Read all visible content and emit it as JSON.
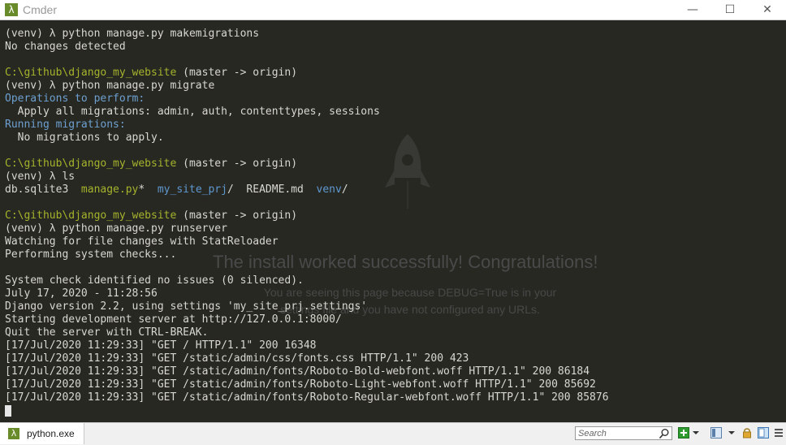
{
  "window": {
    "title": "Cmder",
    "app_icon_glyph": "λ",
    "controls": {
      "minimize": "—",
      "maximize": "☐",
      "close": "✕"
    }
  },
  "watermark": {
    "headline": "The install worked successfully! Congratulations!",
    "body": "You are seeing this page because DEBUG=True is in your settings file and you have not configured any URLs."
  },
  "terminal": {
    "lines": [
      [
        {
          "t": "(venv) λ python manage.py makemigrations",
          "c": "w"
        }
      ],
      [
        {
          "t": "No changes detected",
          "c": "w"
        }
      ],
      [
        {
          "t": "",
          "c": "w"
        }
      ],
      [
        {
          "t": "C:\\github\\django_my_website",
          "c": "g"
        },
        {
          "t": " (master -> origin)",
          "c": "w"
        }
      ],
      [
        {
          "t": "(venv) λ python manage.py migrate",
          "c": "w"
        }
      ],
      [
        {
          "t": "Operations to perform:",
          "c": "c"
        }
      ],
      [
        {
          "t": "  Apply all migrations:",
          "c": "w"
        },
        {
          "t": " admin, auth, contenttypes, sessions",
          "c": "w"
        }
      ],
      [
        {
          "t": "Running migrations:",
          "c": "c"
        }
      ],
      [
        {
          "t": "  No migrations to apply.",
          "c": "w"
        }
      ],
      [
        {
          "t": "",
          "c": "w"
        }
      ],
      [
        {
          "t": "C:\\github\\django_my_website",
          "c": "g"
        },
        {
          "t": " (master -> origin)",
          "c": "w"
        }
      ],
      [
        {
          "t": "(venv) λ ls",
          "c": "w"
        }
      ],
      [
        {
          "t": "db.sqlite3  ",
          "c": "w"
        },
        {
          "t": "manage.py",
          "c": "g"
        },
        {
          "t": "*  ",
          "c": "w"
        },
        {
          "t": "my_site_prj",
          "c": "b"
        },
        {
          "t": "/  README.md  ",
          "c": "w"
        },
        {
          "t": "venv",
          "c": "b"
        },
        {
          "t": "/",
          "c": "w"
        }
      ],
      [
        {
          "t": "",
          "c": "w"
        }
      ],
      [
        {
          "t": "C:\\github\\django_my_website",
          "c": "g"
        },
        {
          "t": " (master -> origin)",
          "c": "w"
        }
      ],
      [
        {
          "t": "(venv) λ python manage.py runserver",
          "c": "w"
        }
      ],
      [
        {
          "t": "Watching for file changes with StatReloader",
          "c": "w"
        }
      ],
      [
        {
          "t": "Performing system checks...",
          "c": "w"
        }
      ],
      [
        {
          "t": "",
          "c": "w"
        }
      ],
      [
        {
          "t": "System check identified no issues (0 silenced).",
          "c": "w"
        }
      ],
      [
        {
          "t": "July 17, 2020 - 11:28:56",
          "c": "w"
        }
      ],
      [
        {
          "t": "Django version 2.2, using settings 'my_site_prj.settings'",
          "c": "w"
        }
      ],
      [
        {
          "t": "Starting development server at http://127.0.0.1:8000/",
          "c": "w"
        }
      ],
      [
        {
          "t": "Quit the server with CTRL-BREAK.",
          "c": "w"
        }
      ],
      [
        {
          "t": "[17/Jul/2020 11:29:33] \"GET / HTTP/1.1\" 200 16348",
          "c": "w"
        }
      ],
      [
        {
          "t": "[17/Jul/2020 11:29:33] \"GET /static/admin/css/fonts.css HTTP/1.1\" 200 423",
          "c": "w"
        }
      ],
      [
        {
          "t": "[17/Jul/2020 11:29:33] \"GET /static/admin/fonts/Roboto-Bold-webfont.woff HTTP/1.1\" 200 86184",
          "c": "w"
        }
      ],
      [
        {
          "t": "[17/Jul/2020 11:29:33] \"GET /static/admin/fonts/Roboto-Light-webfont.woff HTTP/1.1\" 200 85692",
          "c": "w"
        }
      ],
      [
        {
          "t": "[17/Jul/2020 11:29:33] \"GET /static/admin/fonts/Roboto-Regular-webfont.woff HTTP/1.1\" 200 85876",
          "c": "w"
        }
      ]
    ]
  },
  "statusbar": {
    "tab_label": "python.exe",
    "tab_icon_glyph": "λ",
    "search_placeholder": "Search",
    "icons": [
      "search-icon",
      "new-console-icon",
      "dropdown-icon",
      "split-panel-icon",
      "dropdown-icon",
      "lock-icon",
      "panel-layout-icon",
      "menu-icon"
    ]
  },
  "colors": {
    "background": "#272822",
    "prompt_path": "#a6b32c",
    "heading_cyan": "#6da0d0",
    "directory_blue": "#5e98d0",
    "text": "#cfcfc2"
  }
}
